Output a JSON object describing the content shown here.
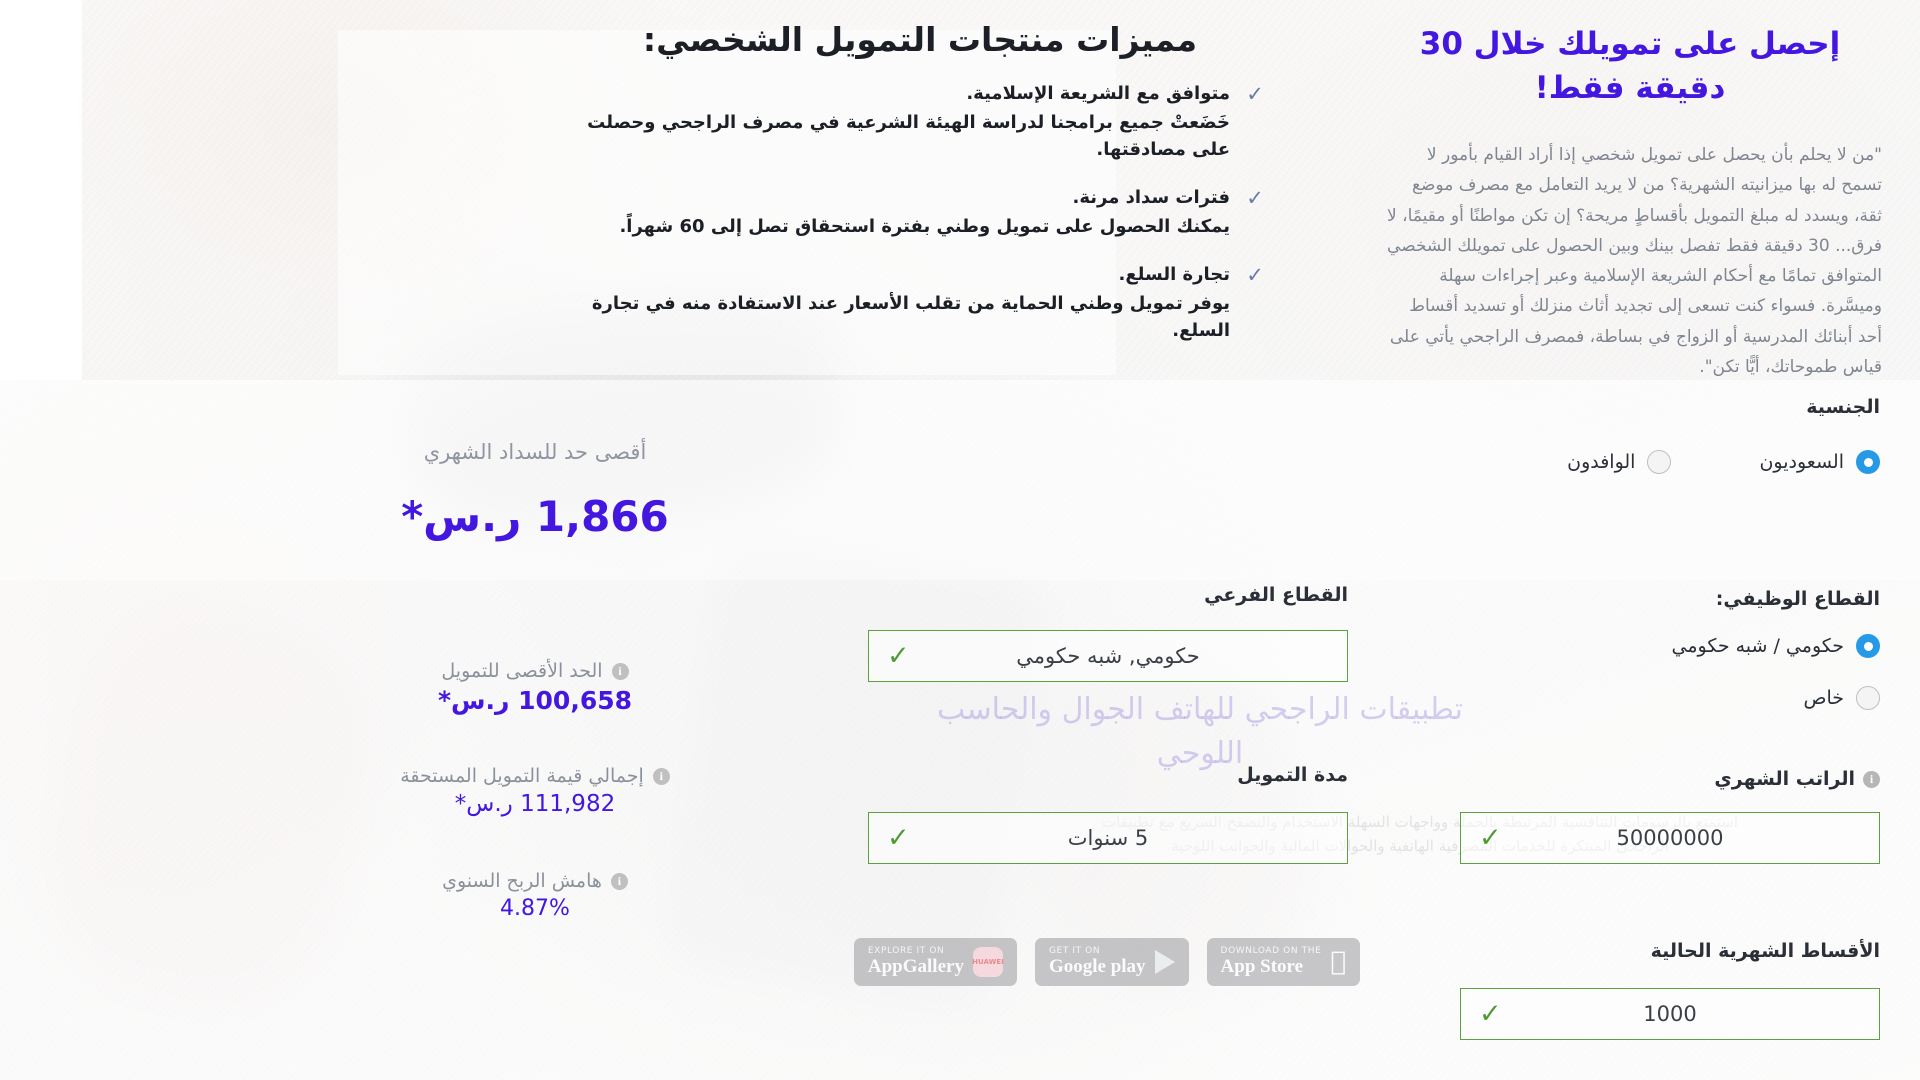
{
  "hero": {
    "title": "إحصل على تمويلك خلال 30 دقيقة فقط!",
    "paragraph": "\"من لا يحلم بأن يحصل على تمويل شخصي إذا أراد القيام بأمور لا تسمح له بها ميزانيته الشهرية؟ من لا يريد التعامل مع مصرف موضع ثقة، ويسدد له مبلغ التمويل بأقساطٍ مريحة؟ إن تكن مواطنًا أو مقيمًا، لا فرق... 30 دقيقة فقط تفصل بينك وبين الحصول على تمويلك الشخصي المتوافق تمامًا مع أحكام الشريعة الإسلامية وعبر إجراءات سهلة وميسَّرة. فسواء كنت تسعى إلى تجديد أثاث منزلك أو تسديد أقساط أحد أبنائك المدرسية أو الزواج في بساطة، فمصرف الراجحي يأتي على قياس طموحاتك، أيًّا تكن\"."
  },
  "features": {
    "title": "مميزات منتجات التمويل الشخصي:",
    "tick_icon": "check-icon",
    "items": [
      {
        "head": "متوافق مع الشريعة الإسلامية.",
        "body": "خَضَعتْ جميع برامجنا لدراسة الهيئة الشرعية في مصرف الراجحي وحصلت على مصادقتها."
      },
      {
        "head": "فترات سداد مرنة.",
        "body": "يمكنك الحصول على تمويل وطني بفترة استحقاق تصل إلى 60 شهراً."
      },
      {
        "head": "تجارة السلع.",
        "body": "يوفر تمويل وطني الحماية من تقلب الأسعار عند الاستفادة منه في تجارة السلع."
      }
    ]
  },
  "form": {
    "nationality": {
      "label": "الجنسية",
      "options": [
        {
          "label": "السعوديون",
          "selected": true
        },
        {
          "label": "الوافدون",
          "selected": false
        }
      ]
    },
    "sector": {
      "label": "القطاع الوظيفي:",
      "options": [
        {
          "label": "حكومي / شبه حكومي",
          "selected": true
        },
        {
          "label": "خاص",
          "selected": false
        }
      ]
    },
    "subsector": {
      "label": "القطاع الفرعي",
      "value": "حكومي, شبه حكومي",
      "valid": true
    },
    "salary": {
      "label": "الراتب الشهري",
      "info_icon": "info-icon",
      "value": "50000000",
      "valid": true
    },
    "duration": {
      "label": "مدة التمويل",
      "value": "5 سنوات",
      "valid": true
    },
    "installments": {
      "label": "الأقساط الشهرية الحالية",
      "value": "1000",
      "valid": true
    },
    "valid_icon": "check-icon"
  },
  "results": {
    "max_monthly_label": "أقصى حد للسداد الشهري",
    "max_monthly_value": "1,866 ر.س*",
    "items": [
      {
        "label": "الحد الأقصى للتمويل",
        "value": "100,658 ر.س*",
        "info_icon": "info-icon"
      },
      {
        "label": "إجمالي قيمة التمويل المستحقة",
        "value": "111,982 ر.س*",
        "info_icon": "info-icon"
      },
      {
        "label": "هامش الربح السنوي",
        "value": "4.87%",
        "info_icon": "info-icon"
      }
    ]
  },
  "watermark": {
    "promo_title": "تطبيقات الراجحي للهاتف الجوال والحاسب اللوحي",
    "promo_sub": "استمتع بالرسومات التنافسية المرتبطة بالحملة وواجهات السهلة الاستخدام والتصفح السريع مع تطبيقات الراجحي المبتكرة للخدمات المصرفية الهاتفية والحوالات المالية والجوانب اللوحية"
  },
  "badges": [
    {
      "id": "appgallery",
      "sub": "EXPLORE IT ON",
      "main": "AppGallery",
      "icon": "huawei-icon"
    },
    {
      "id": "googleplay",
      "sub": "GET IT ON",
      "main": "Google play",
      "icon": "play-triangle-icon"
    },
    {
      "id": "appstore",
      "sub": "Download on the",
      "main": "App Store",
      "icon": "apple-icon"
    }
  ],
  "colors": {
    "accent_purple": "#4317e0",
    "radio_blue": "#269ae6",
    "valid_green": "#5da03e",
    "muted_gray": "#8b919c"
  }
}
